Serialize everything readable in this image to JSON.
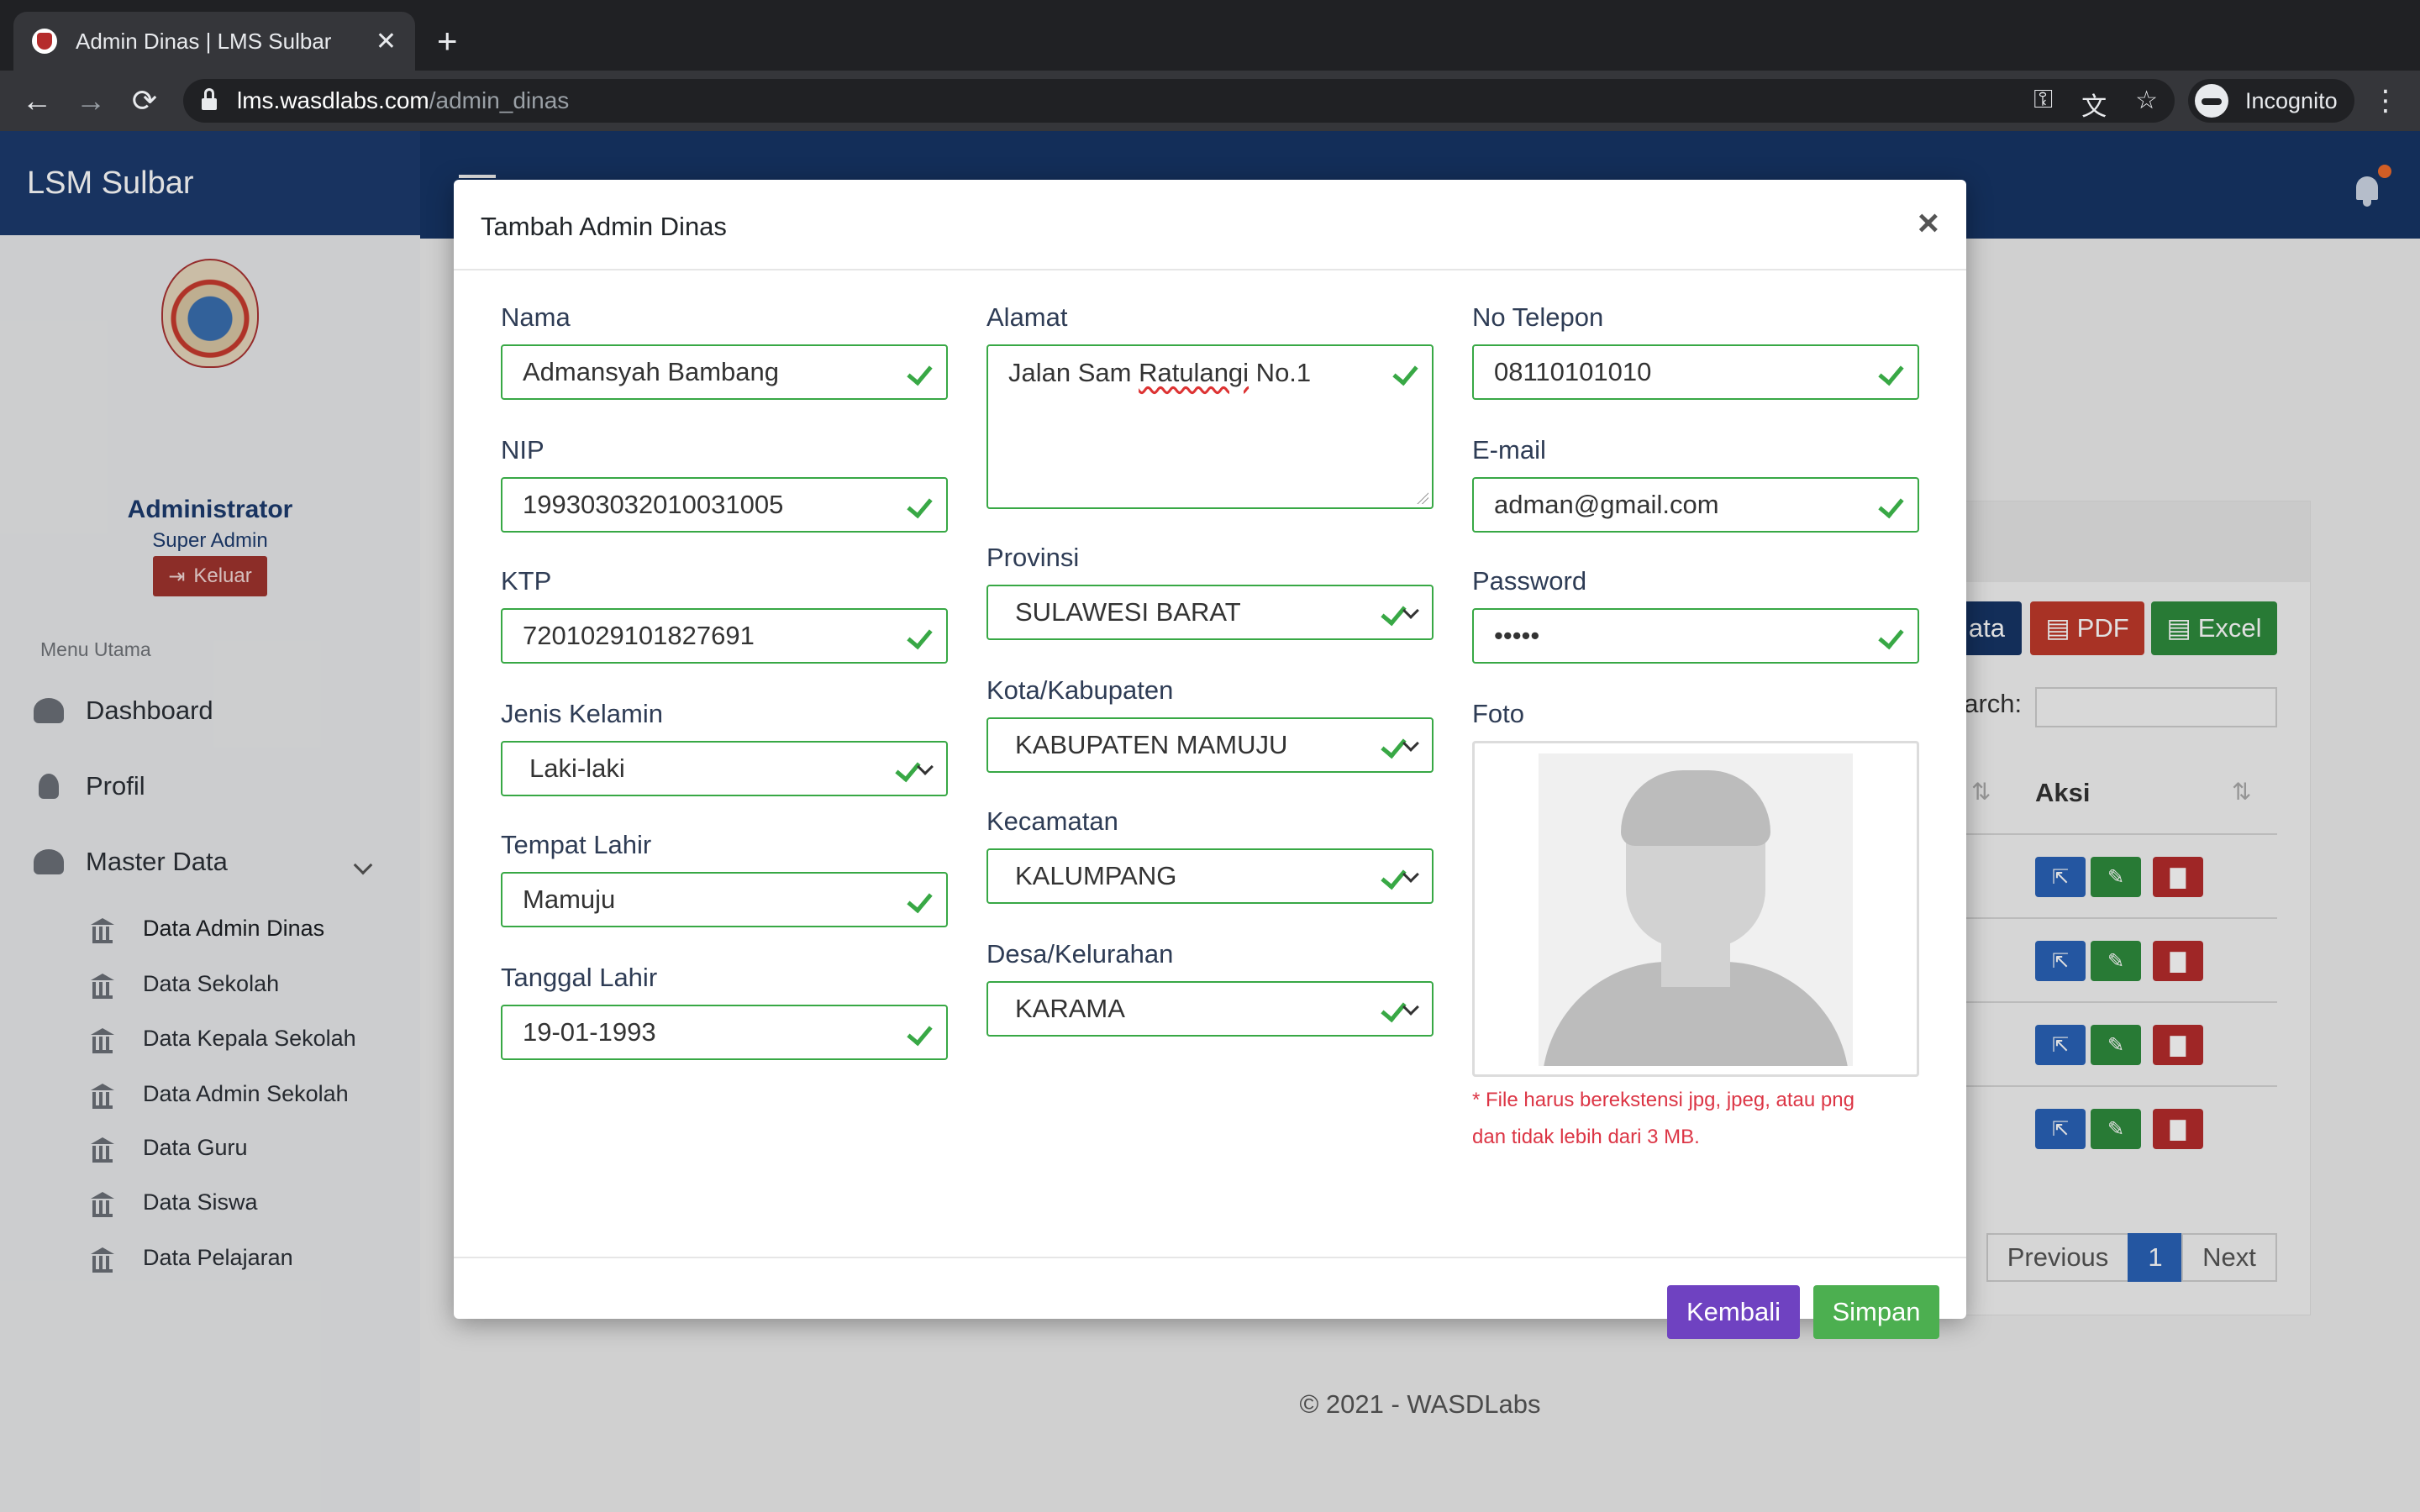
{
  "browser": {
    "tab_title": "Admin Dinas | LMS Sulbar",
    "tab_close": "✕",
    "new_tab": "+",
    "url_host": "lms.wasdlabs.com",
    "url_path": "/admin_dinas",
    "profile_label": "Incognito",
    "back": "←",
    "forward": "→",
    "reload": "⟳",
    "key": "⚿",
    "translate": "文",
    "star": "☆",
    "more": "⋮"
  },
  "app": {
    "brand": "LSM Sulbar",
    "user_name": "Administrator",
    "user_role": "Super Admin",
    "logout_label": "Keluar",
    "menu_heading": "Menu Utama",
    "nav": [
      {
        "label": "Dashboard"
      },
      {
        "label": "Profil"
      },
      {
        "label": "Master Data"
      }
    ],
    "sub_nav": [
      {
        "label": "Data Admin Dinas"
      },
      {
        "label": "Data Sekolah"
      },
      {
        "label": "Data Kepala Sekolah"
      },
      {
        "label": "Data Admin Sekolah"
      },
      {
        "label": "Data Guru"
      },
      {
        "label": "Data Siswa"
      },
      {
        "label": "Data Pelajaran"
      }
    ],
    "toolbar": {
      "data_partial": "ata",
      "pdf": "PDF",
      "excel": "Excel"
    },
    "search_label": "earch:",
    "column_aksi": "Aksi",
    "pagination": {
      "previous": "Previous",
      "page": "1",
      "next": "Next"
    },
    "footer": "© 2021 - WASDLabs"
  },
  "modal": {
    "title": "Tambah Admin Dinas",
    "close": "×",
    "fields": {
      "nama": {
        "label": "Nama",
        "value": "Admansyah Bambang"
      },
      "nip": {
        "label": "NIP",
        "value": "199303032010031005"
      },
      "ktp": {
        "label": "KTP",
        "value": "7201029101827691"
      },
      "jenis_kelamin": {
        "label": "Jenis Kelamin",
        "value": "Laki-laki"
      },
      "tempat_lahir": {
        "label": "Tempat Lahir",
        "value": "Mamuju"
      },
      "tanggal_lahir": {
        "label": "Tanggal Lahir",
        "value": "19-01-1993"
      },
      "alamat": {
        "label": "Alamat",
        "value_pre": "Jalan Sam ",
        "value_spell": "Ratulangi",
        "value_post": " No.1"
      },
      "provinsi": {
        "label": "Provinsi",
        "value": "SULAWESI BARAT"
      },
      "kota": {
        "label": "Kota/Kabupaten",
        "value": "KABUPATEN MAMUJU"
      },
      "kecamatan": {
        "label": "Kecamatan",
        "value": "KALUMPANG"
      },
      "desa": {
        "label": "Desa/Kelurahan",
        "value": "KARAMA"
      },
      "telepon": {
        "label": "No Telepon",
        "value": "08110101010"
      },
      "email": {
        "label": "E-mail",
        "value": "adman@gmail.com"
      },
      "password": {
        "label": "Password",
        "value": "•••••"
      },
      "foto": {
        "label": "Foto"
      }
    },
    "note_line1_a": "* File harus berekstensi ",
    "note_line1_b": "jpg, jpeg, atau png",
    "note_line2_a": "dan tidak lebih dari ",
    "note_line2_b": "3 MB",
    "note_line2_c": ".",
    "buttons": {
      "back": "Kembali",
      "save": "Simpan"
    }
  },
  "colors": {
    "navbar": "#163566",
    "valid_green": "#38a845",
    "back_purple": "#6f42c1",
    "save_green": "#4caf50",
    "danger": "#dc3545"
  }
}
